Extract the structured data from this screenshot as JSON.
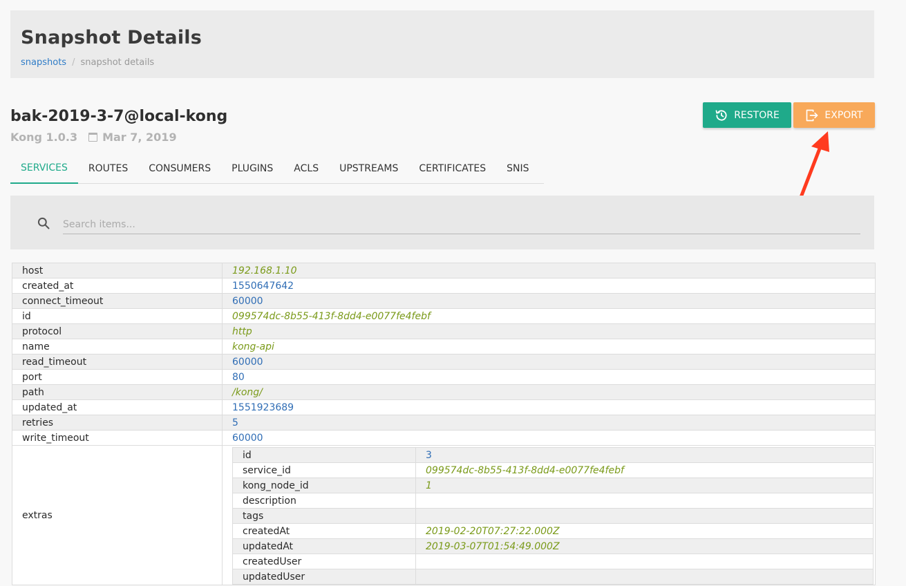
{
  "header": {
    "title": "Snapshot Details",
    "breadcrumb": {
      "link": "snapshots",
      "separator": "/",
      "current": "snapshot details"
    }
  },
  "snapshot": {
    "name": "bak-2019-3-7@local-kong",
    "version": "Kong 1.0.3",
    "date": "Mar 7, 2019"
  },
  "actions": {
    "restore_label": "RESTORE",
    "export_label": "EXPORT",
    "restore_color": "#1faa8a",
    "export_color": "#f8a95a"
  },
  "tabs": [
    {
      "label": "SERVICES",
      "active": true
    },
    {
      "label": "ROUTES"
    },
    {
      "label": "CONSUMERS"
    },
    {
      "label": "PLUGINS"
    },
    {
      "label": "ACLS"
    },
    {
      "label": "UPSTREAMS"
    },
    {
      "label": "CERTIFICATES"
    },
    {
      "label": "SNIS"
    }
  ],
  "search": {
    "placeholder": "Search items..."
  },
  "service": {
    "rows": [
      {
        "key": "host",
        "value": "192.168.1.10",
        "type": "string"
      },
      {
        "key": "created_at",
        "value": "1550647642",
        "type": "number"
      },
      {
        "key": "connect_timeout",
        "value": "60000",
        "type": "number"
      },
      {
        "key": "id",
        "value": "099574dc-8b55-413f-8dd4-e0077fe4febf",
        "type": "string"
      },
      {
        "key": "protocol",
        "value": "http",
        "type": "string"
      },
      {
        "key": "name",
        "value": "kong-api",
        "type": "string"
      },
      {
        "key": "read_timeout",
        "value": "60000",
        "type": "number"
      },
      {
        "key": "port",
        "value": "80",
        "type": "number"
      },
      {
        "key": "path",
        "value": "/kong/",
        "type": "string"
      },
      {
        "key": "updated_at",
        "value": "1551923689",
        "type": "number"
      },
      {
        "key": "retries",
        "value": "5",
        "type": "number"
      },
      {
        "key": "write_timeout",
        "value": "60000",
        "type": "number"
      }
    ],
    "extras": {
      "key": "extras",
      "rows": [
        {
          "key": "id",
          "value": "3",
          "type": "number"
        },
        {
          "key": "service_id",
          "value": "099574dc-8b55-413f-8dd4-e0077fe4febf",
          "type": "string"
        },
        {
          "key": "kong_node_id",
          "value": "1",
          "type": "string"
        },
        {
          "key": "description",
          "value": "",
          "type": "string"
        },
        {
          "key": "tags",
          "value": "",
          "type": "string"
        },
        {
          "key": "createdAt",
          "value": "2019-02-20T07:27:22.000Z",
          "type": "string"
        },
        {
          "key": "updatedAt",
          "value": "2019-03-07T01:54:49.000Z",
          "type": "string"
        },
        {
          "key": "createdUser",
          "value": "",
          "type": "string"
        },
        {
          "key": "updatedUser",
          "value": "",
          "type": "string"
        }
      ]
    }
  },
  "annotation": {
    "arrow_color": "#ff3b1f"
  }
}
